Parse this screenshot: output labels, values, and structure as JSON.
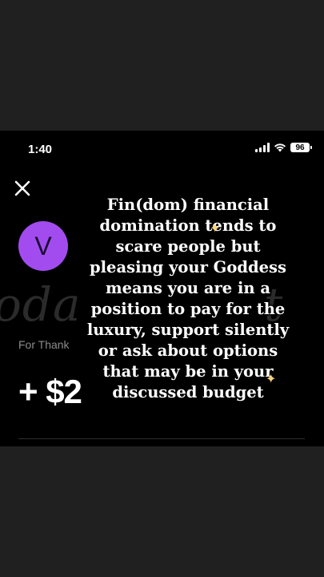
{
  "status_bar": {
    "time": "1:40",
    "battery": "96",
    "icons": [
      "signal-icon",
      "wifi-icon",
      "battery-icon"
    ]
  },
  "header": {
    "close_icon": "close-icon"
  },
  "payment": {
    "avatar_initial": "V",
    "avatar_color": "#a24cf0",
    "watermark_text": "oda",
    "watermark_right": "t",
    "for_label": "For Thank",
    "amount": "+ $2"
  },
  "overlay": {
    "text": "Fin(dom) financial domination tends to scare people but pleasing your Goddess means you are in a position to pay for the luxury, support silently or ask about options that may be in your discussed budget"
  },
  "colors": {
    "screen_bg": "#000000",
    "frame_bg": "#202020",
    "accent": "#a24cf0",
    "sparkle": "#f7d27a"
  }
}
